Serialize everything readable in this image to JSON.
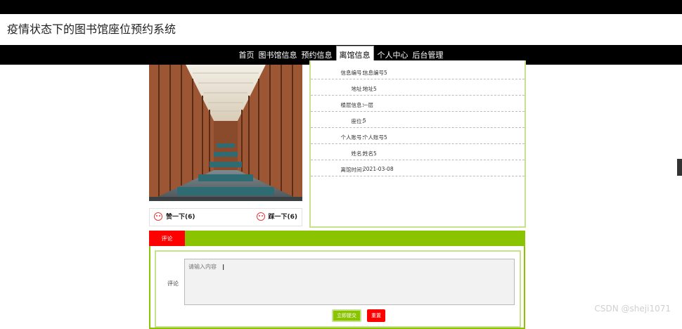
{
  "header": {
    "site_title": "疫情状态下的图书馆座位预约系统"
  },
  "nav": {
    "items": [
      {
        "label": "首页"
      },
      {
        "label": "图书馆信息"
      },
      {
        "label": "预约信息"
      },
      {
        "label": "离馆信息",
        "active": true
      },
      {
        "label": "个人中心"
      },
      {
        "label": "后台管理"
      }
    ]
  },
  "detail": {
    "rows": [
      {
        "label": "信息编号：",
        "value": "信息编号5"
      },
      {
        "label": "地址：",
        "value": "地址5"
      },
      {
        "label": "楼层信息：",
        "value": "一层"
      },
      {
        "label": "座位：",
        "value": "5"
      },
      {
        "label": "个人账号：",
        "value": "个人账号5"
      },
      {
        "label": "姓名：",
        "value": "姓名5"
      },
      {
        "label": "离馆时间：",
        "value": "2021-03-08"
      }
    ]
  },
  "votes": {
    "like_label": "赞一下(6)",
    "dislike_label": "踩一下(6)"
  },
  "comment": {
    "tab_label": "评论",
    "field_label": "评论",
    "placeholder": "请输入内容",
    "submit_label": "立即提交",
    "reset_label": "重置"
  },
  "watermark": "CSDN @sheji1071",
  "colors": {
    "accent_green": "#8ac300",
    "tab_red": "#ff0000",
    "nav_bg": "#000000"
  }
}
